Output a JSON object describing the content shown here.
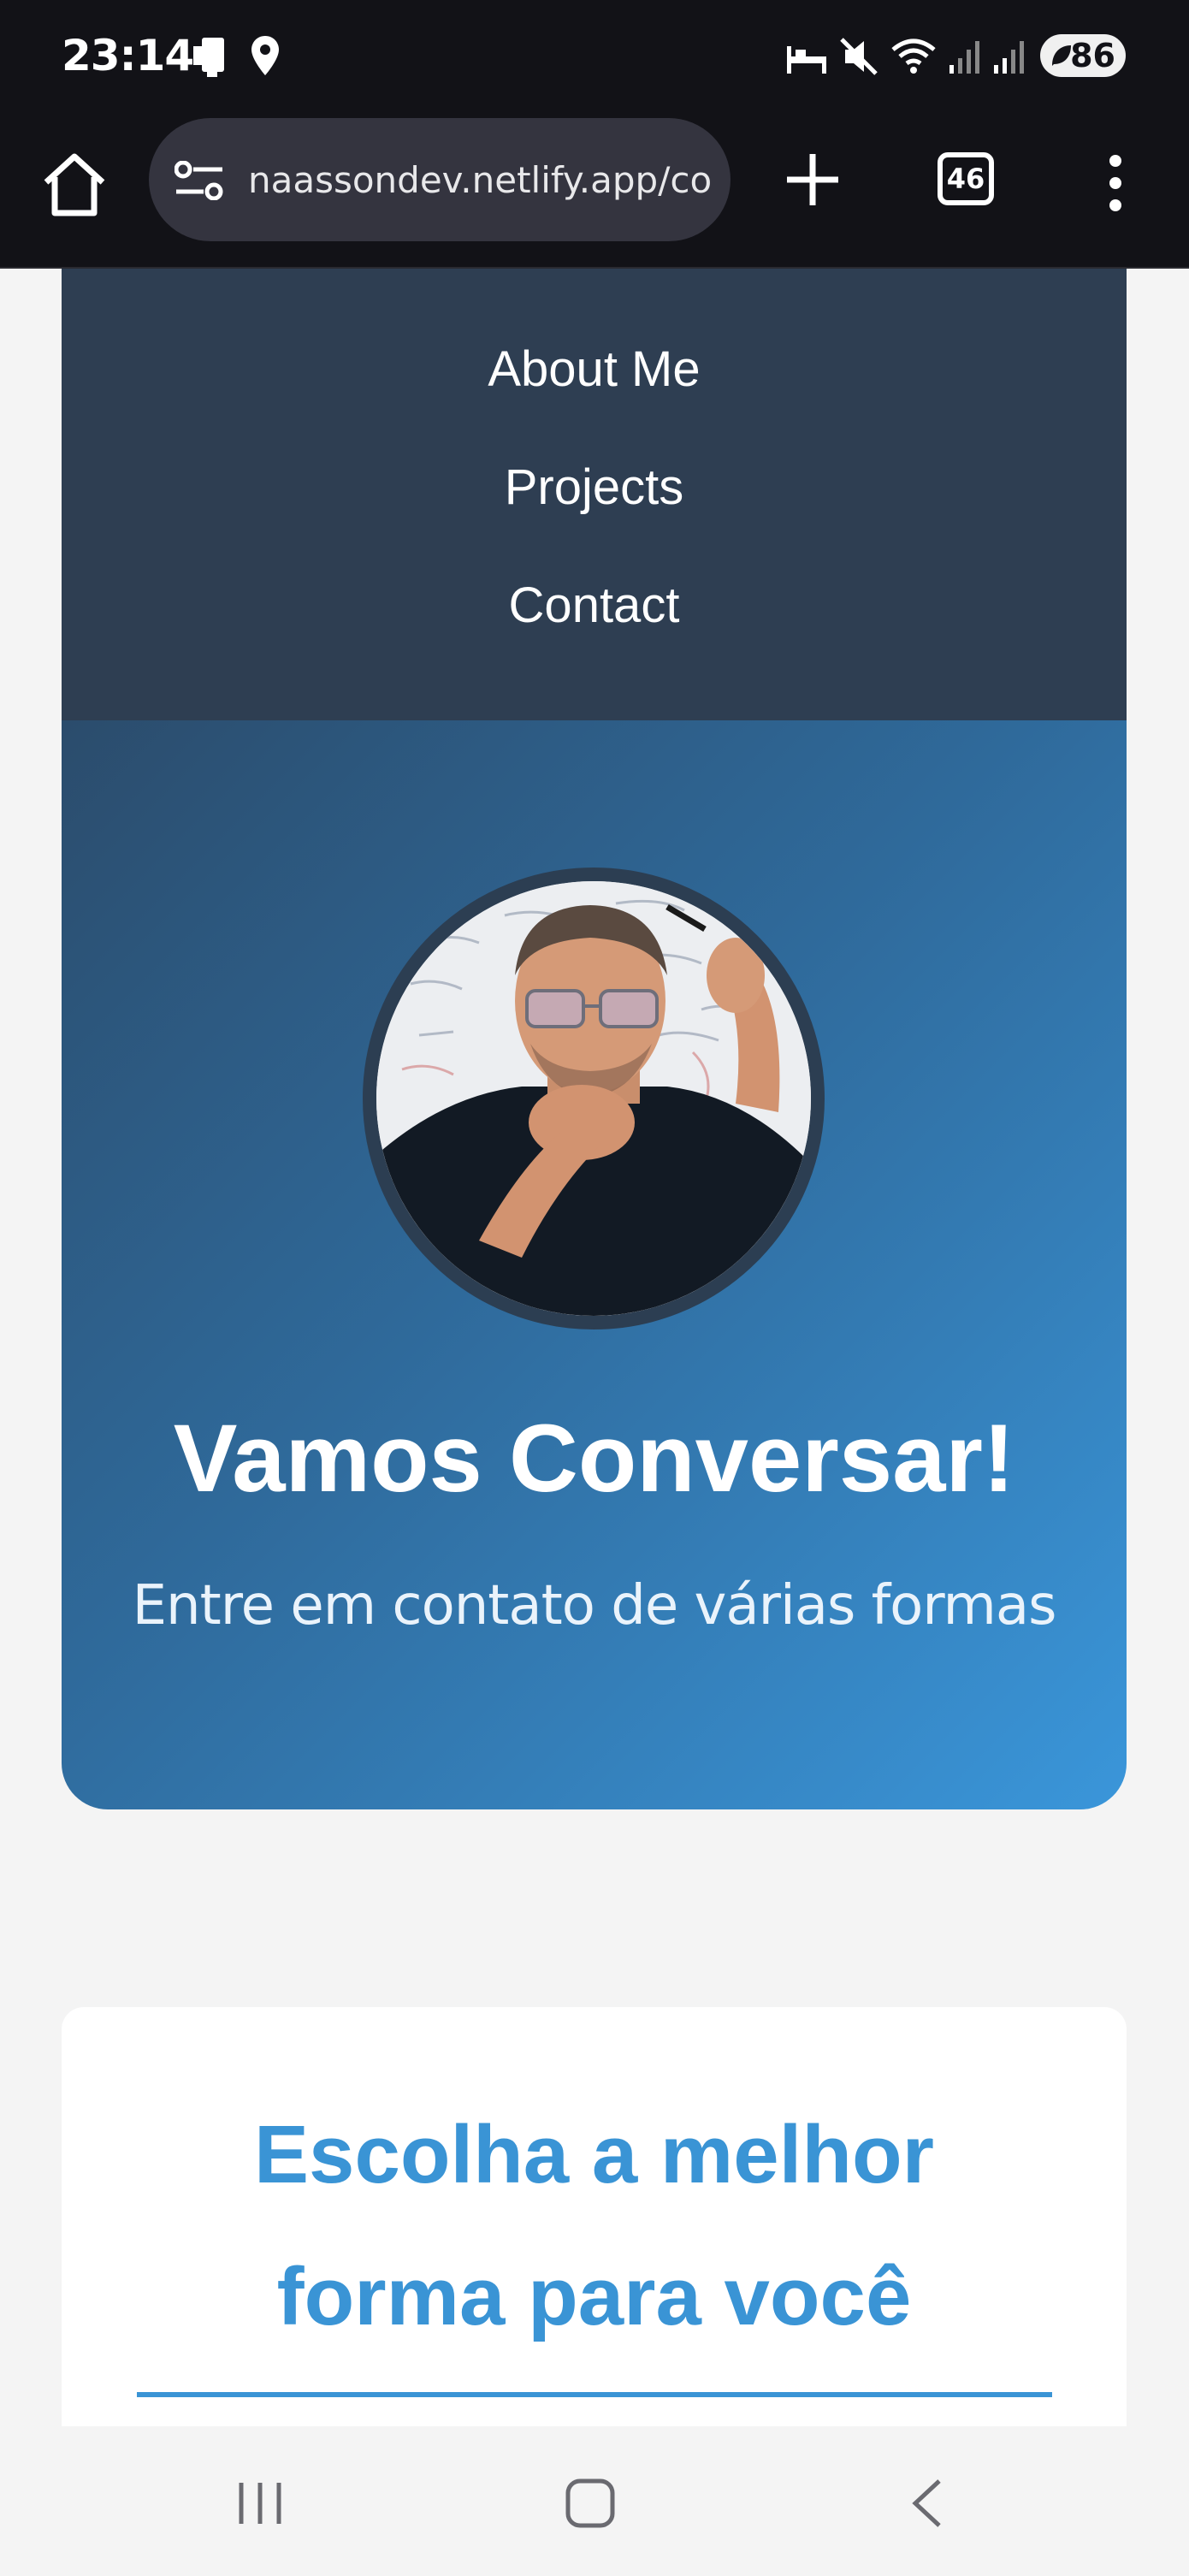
{
  "status_bar": {
    "time": "23:14",
    "battery": "86",
    "icons": [
      "phone-sync-icon",
      "location-icon",
      "sleep-mode-icon",
      "mute-icon",
      "wifi-icon",
      "signal-icon",
      "signal-icon",
      "battery-icon"
    ]
  },
  "browser": {
    "url": "naassondev.netlify.app/contact",
    "tab_count": "46",
    "icons": [
      "home-icon",
      "site-settings-icon",
      "new-tab-icon",
      "tab-switcher-icon",
      "more-menu-icon"
    ]
  },
  "nav": {
    "items": [
      {
        "label": "About Me"
      },
      {
        "label": "Projects"
      },
      {
        "label": "Contact"
      }
    ]
  },
  "hero": {
    "title": "Vamos Conversar!",
    "subtitle": "Entre em contato de várias formas",
    "avatar": "profile-photo"
  },
  "card": {
    "title": "Escolha a melhor forma para você"
  },
  "colors": {
    "nav_bg": "#2e3e52",
    "accent": "#3a94d5",
    "page_bg": "#f4f4f4",
    "browser_bg": "#121217"
  }
}
